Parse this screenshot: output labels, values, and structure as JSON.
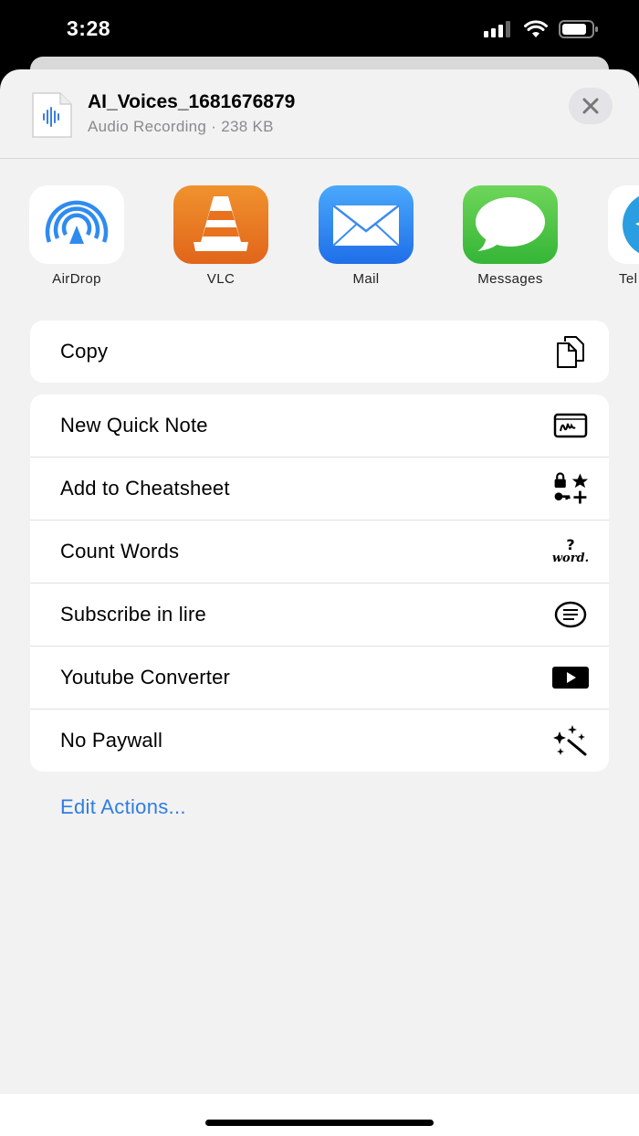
{
  "status": {
    "time": "3:28"
  },
  "file": {
    "name": "AI_Voices_1681676879",
    "subtitle": "Audio Recording · 238 KB"
  },
  "apps": [
    {
      "label": "AirDrop",
      "icon": "airdrop-icon"
    },
    {
      "label": "VLC",
      "icon": "vlc-cone-icon"
    },
    {
      "label": "Mail",
      "icon": "mail-envelope-icon"
    },
    {
      "label": "Messages",
      "icon": "message-bubble-icon"
    },
    {
      "label": "Tel",
      "icon": "telegram-icon"
    }
  ],
  "actions": {
    "copy": "Copy",
    "group2": [
      {
        "label": "New Quick Note",
        "icon": "quick-note-icon"
      },
      {
        "label": "Add to Cheatsheet",
        "icon": "cheatsheet-icon"
      },
      {
        "label": "Count Words",
        "icon": "word-count-icon"
      },
      {
        "label": "Subscribe in lire",
        "icon": "text-bubble-icon"
      },
      {
        "label": "Youtube Converter",
        "icon": "play-button-icon"
      },
      {
        "label": "No Paywall",
        "icon": "magic-wand-icon"
      }
    ],
    "word_icon_q": "?",
    "word_icon_text": "word."
  },
  "edit_actions": "Edit Actions...",
  "colors": {
    "accent": "#2f7de1",
    "sheet_bg": "#f2f2f2"
  }
}
